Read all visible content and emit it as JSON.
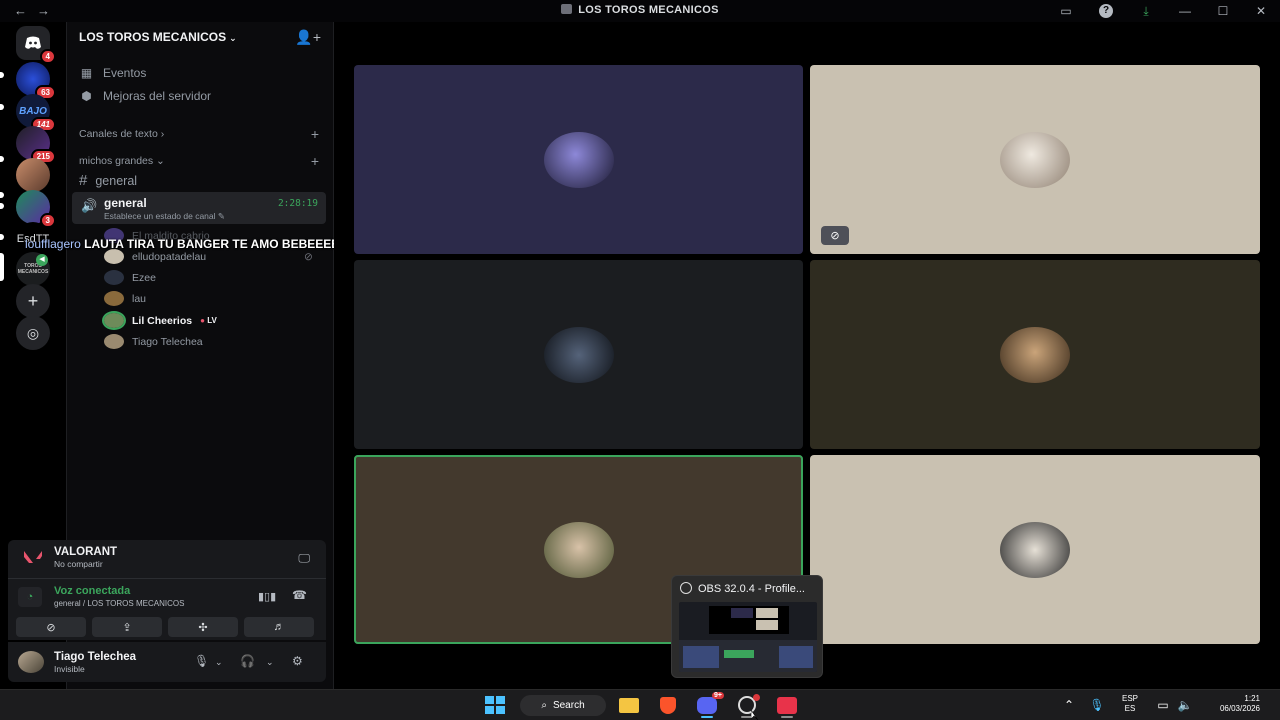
{
  "window": {
    "title": "LOS TOROS MECANICOS",
    "nav_icons": [
      "back-arrow-icon",
      "forward-arrow-icon"
    ]
  },
  "rail": {
    "servers": [
      {
        "badge": "4"
      },
      {
        "badge": "63"
      },
      {
        "label": "BAJO",
        "badge": "141"
      },
      {
        "badge": "215"
      },
      {
        "badge": ""
      },
      {
        "badge": "3"
      },
      {
        "label": "EsdTT",
        "badge": ""
      },
      {
        "label": "TOROS MECANICOS",
        "badge": ""
      }
    ]
  },
  "sidebar": {
    "server_name": "LOS TOROS MECANICOS",
    "menu": [
      {
        "label": "Eventos",
        "icon": "calendar-icon"
      },
      {
        "label": "Mejoras del servidor",
        "icon": "boost-icon"
      }
    ],
    "categories": [
      {
        "label": "Canales de texto",
        "chevron": "›"
      },
      {
        "label": "michos grandes",
        "chevron": "⌄"
      }
    ],
    "text_channel": "general",
    "voice_channel": {
      "name": "general",
      "status": "Establece un estado de canal",
      "timer": "2:28:19"
    },
    "members": [
      {
        "name": "El maldito cabrio",
        "tag": ""
      },
      {
        "name": "elludopatadelau",
        "tag": ""
      },
      {
        "name": "Ezee",
        "tag": ""
      },
      {
        "name": "lau",
        "tag": ""
      },
      {
        "name": "Lil Cheerios",
        "tag": "LV"
      },
      {
        "name": "Tiago Telechea",
        "tag": ""
      }
    ]
  },
  "overlay": {
    "user": "loufflagero",
    "message": "LAUTA TIRA TU BANGER TE AMO BEBEEEEE"
  },
  "activity": {
    "game": "VALORANT",
    "status": "No compartir"
  },
  "voice_panel": {
    "status": "Voz conectada",
    "channel": "general / LOS TOROS MECANICOS"
  },
  "user": {
    "name": "Tiago Telechea",
    "status": "Invisible"
  },
  "tiles": [
    {
      "bg": "#2c2a4a",
      "speaking": false,
      "muted": false
    },
    {
      "bg": "#c9c1b1",
      "speaking": false,
      "muted": true
    },
    {
      "bg": "#1b1d20",
      "speaking": false,
      "muted": false
    },
    {
      "bg": "#2f2c20",
      "speaking": false,
      "muted": false
    },
    {
      "bg": "#43392d",
      "speaking": true,
      "muted": false
    },
    {
      "bg": "#c9c1b1",
      "speaking": false,
      "muted": false
    }
  ],
  "obs_popup": {
    "title": "OBS 32.0.4 - Profile..."
  },
  "taskbar": {
    "search": "Search",
    "lang_top": "ESP",
    "lang_bottom": "ES",
    "time": "1:21",
    "date": "06/03/2026",
    "discord_badge": "9+"
  },
  "colors": {
    "accent_green": "#3ba55c",
    "badge_red": "#da373c",
    "blurple": "#5865f2"
  }
}
